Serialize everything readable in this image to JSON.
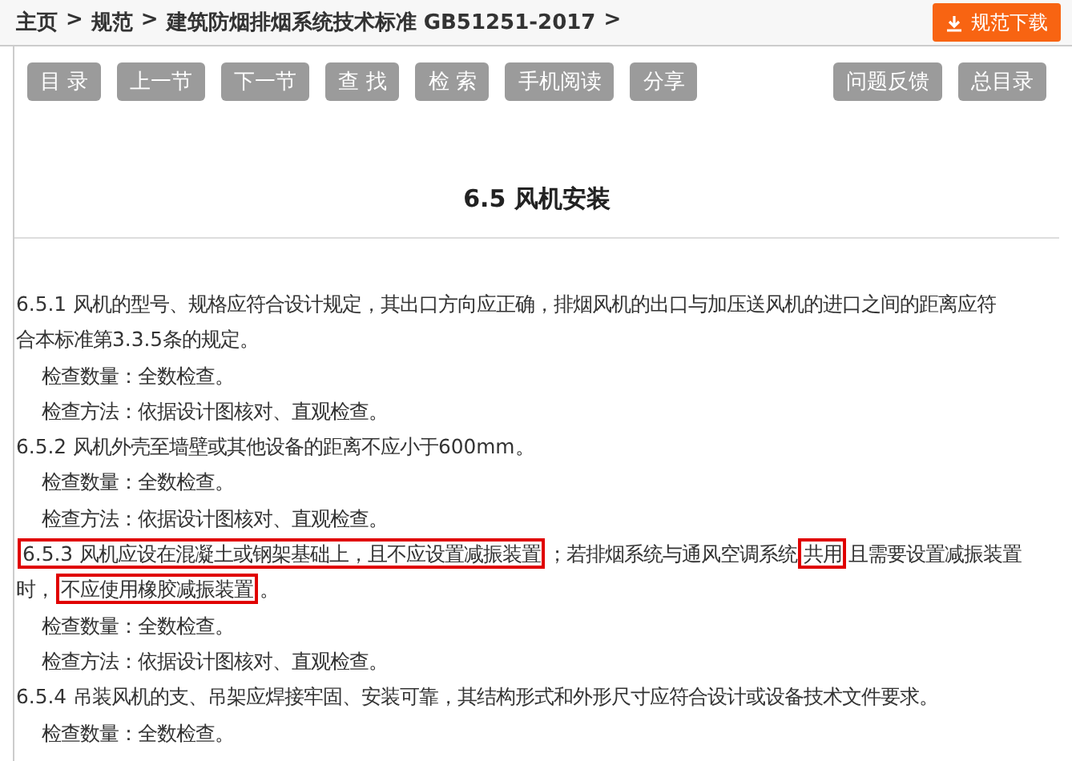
{
  "breadcrumb": [
    "主页",
    ">",
    "规范",
    ">",
    "建筑防烟排烟系统技术标准 GB51251-2017",
    ">"
  ],
  "download_button": {
    "label": "规范下载"
  },
  "toolbar": {
    "left": [
      "目 录",
      "上一节",
      "下一节",
      "查 找",
      "检 索",
      "手机阅读",
      "分享"
    ],
    "right": [
      "问题反馈",
      "总目录"
    ]
  },
  "section_title": "6.5 风机安装",
  "lines": [
    {
      "kind": "clause",
      "segments": [
        {
          "text": "6.5.1 风机的型号、规格应符合设计规定，其出口方向应正确，排烟风机的出口与加压送风机的进口之间的距离应符",
          "highlighted": false
        }
      ]
    },
    {
      "kind": "clause",
      "segments": [
        {
          "text": "合本标准第3.3.5条的规定。",
          "highlighted": false
        }
      ]
    },
    {
      "kind": "check",
      "segments": [
        {
          "text": "检查数量：全数检查。",
          "highlighted": false
        }
      ]
    },
    {
      "kind": "check",
      "segments": [
        {
          "text": "检查方法：依据设计图核对、直观检查。",
          "highlighted": false
        }
      ]
    },
    {
      "kind": "clause",
      "segments": [
        {
          "text": "6.5.2 风机外壳至墙壁或其他设备的距离不应小于600mm。",
          "highlighted": false
        }
      ]
    },
    {
      "kind": "check",
      "segments": [
        {
          "text": "检查数量：全数检查。",
          "highlighted": false
        }
      ]
    },
    {
      "kind": "check",
      "segments": [
        {
          "text": "检查方法：依据设计图核对、直观检查。",
          "highlighted": false
        }
      ]
    },
    {
      "kind": "clause",
      "segments": [
        {
          "text": "6.5.3 风机应设在混凝土或钢架基础上，且不应设置减振装置",
          "highlighted": true
        },
        {
          "text": "；若排烟系统与通风空调系统",
          "highlighted": false
        },
        {
          "text": "共用",
          "highlighted": true
        },
        {
          "text": "且需要设置减振装置",
          "highlighted": false
        }
      ]
    },
    {
      "kind": "clause",
      "segments": [
        {
          "text": "时，",
          "highlighted": false
        },
        {
          "text": "不应使用橡胶减振装置",
          "highlighted": true
        },
        {
          "text": "。",
          "highlighted": false
        }
      ]
    },
    {
      "kind": "check",
      "segments": [
        {
          "text": "检查数量：全数检查。",
          "highlighted": false
        }
      ]
    },
    {
      "kind": "check",
      "segments": [
        {
          "text": "检查方法：依据设计图核对、直观检查。",
          "highlighted": false
        }
      ]
    },
    {
      "kind": "clause",
      "segments": [
        {
          "text": "6.5.4 吊装风机的支、吊架应焊接牢固、安装可靠，其结构形式和外形尺寸应符合设计或设备技术文件要求。",
          "highlighted": false
        }
      ]
    },
    {
      "kind": "check",
      "segments": [
        {
          "text": "检查数量：全数检查。",
          "highlighted": false
        }
      ]
    }
  ]
}
